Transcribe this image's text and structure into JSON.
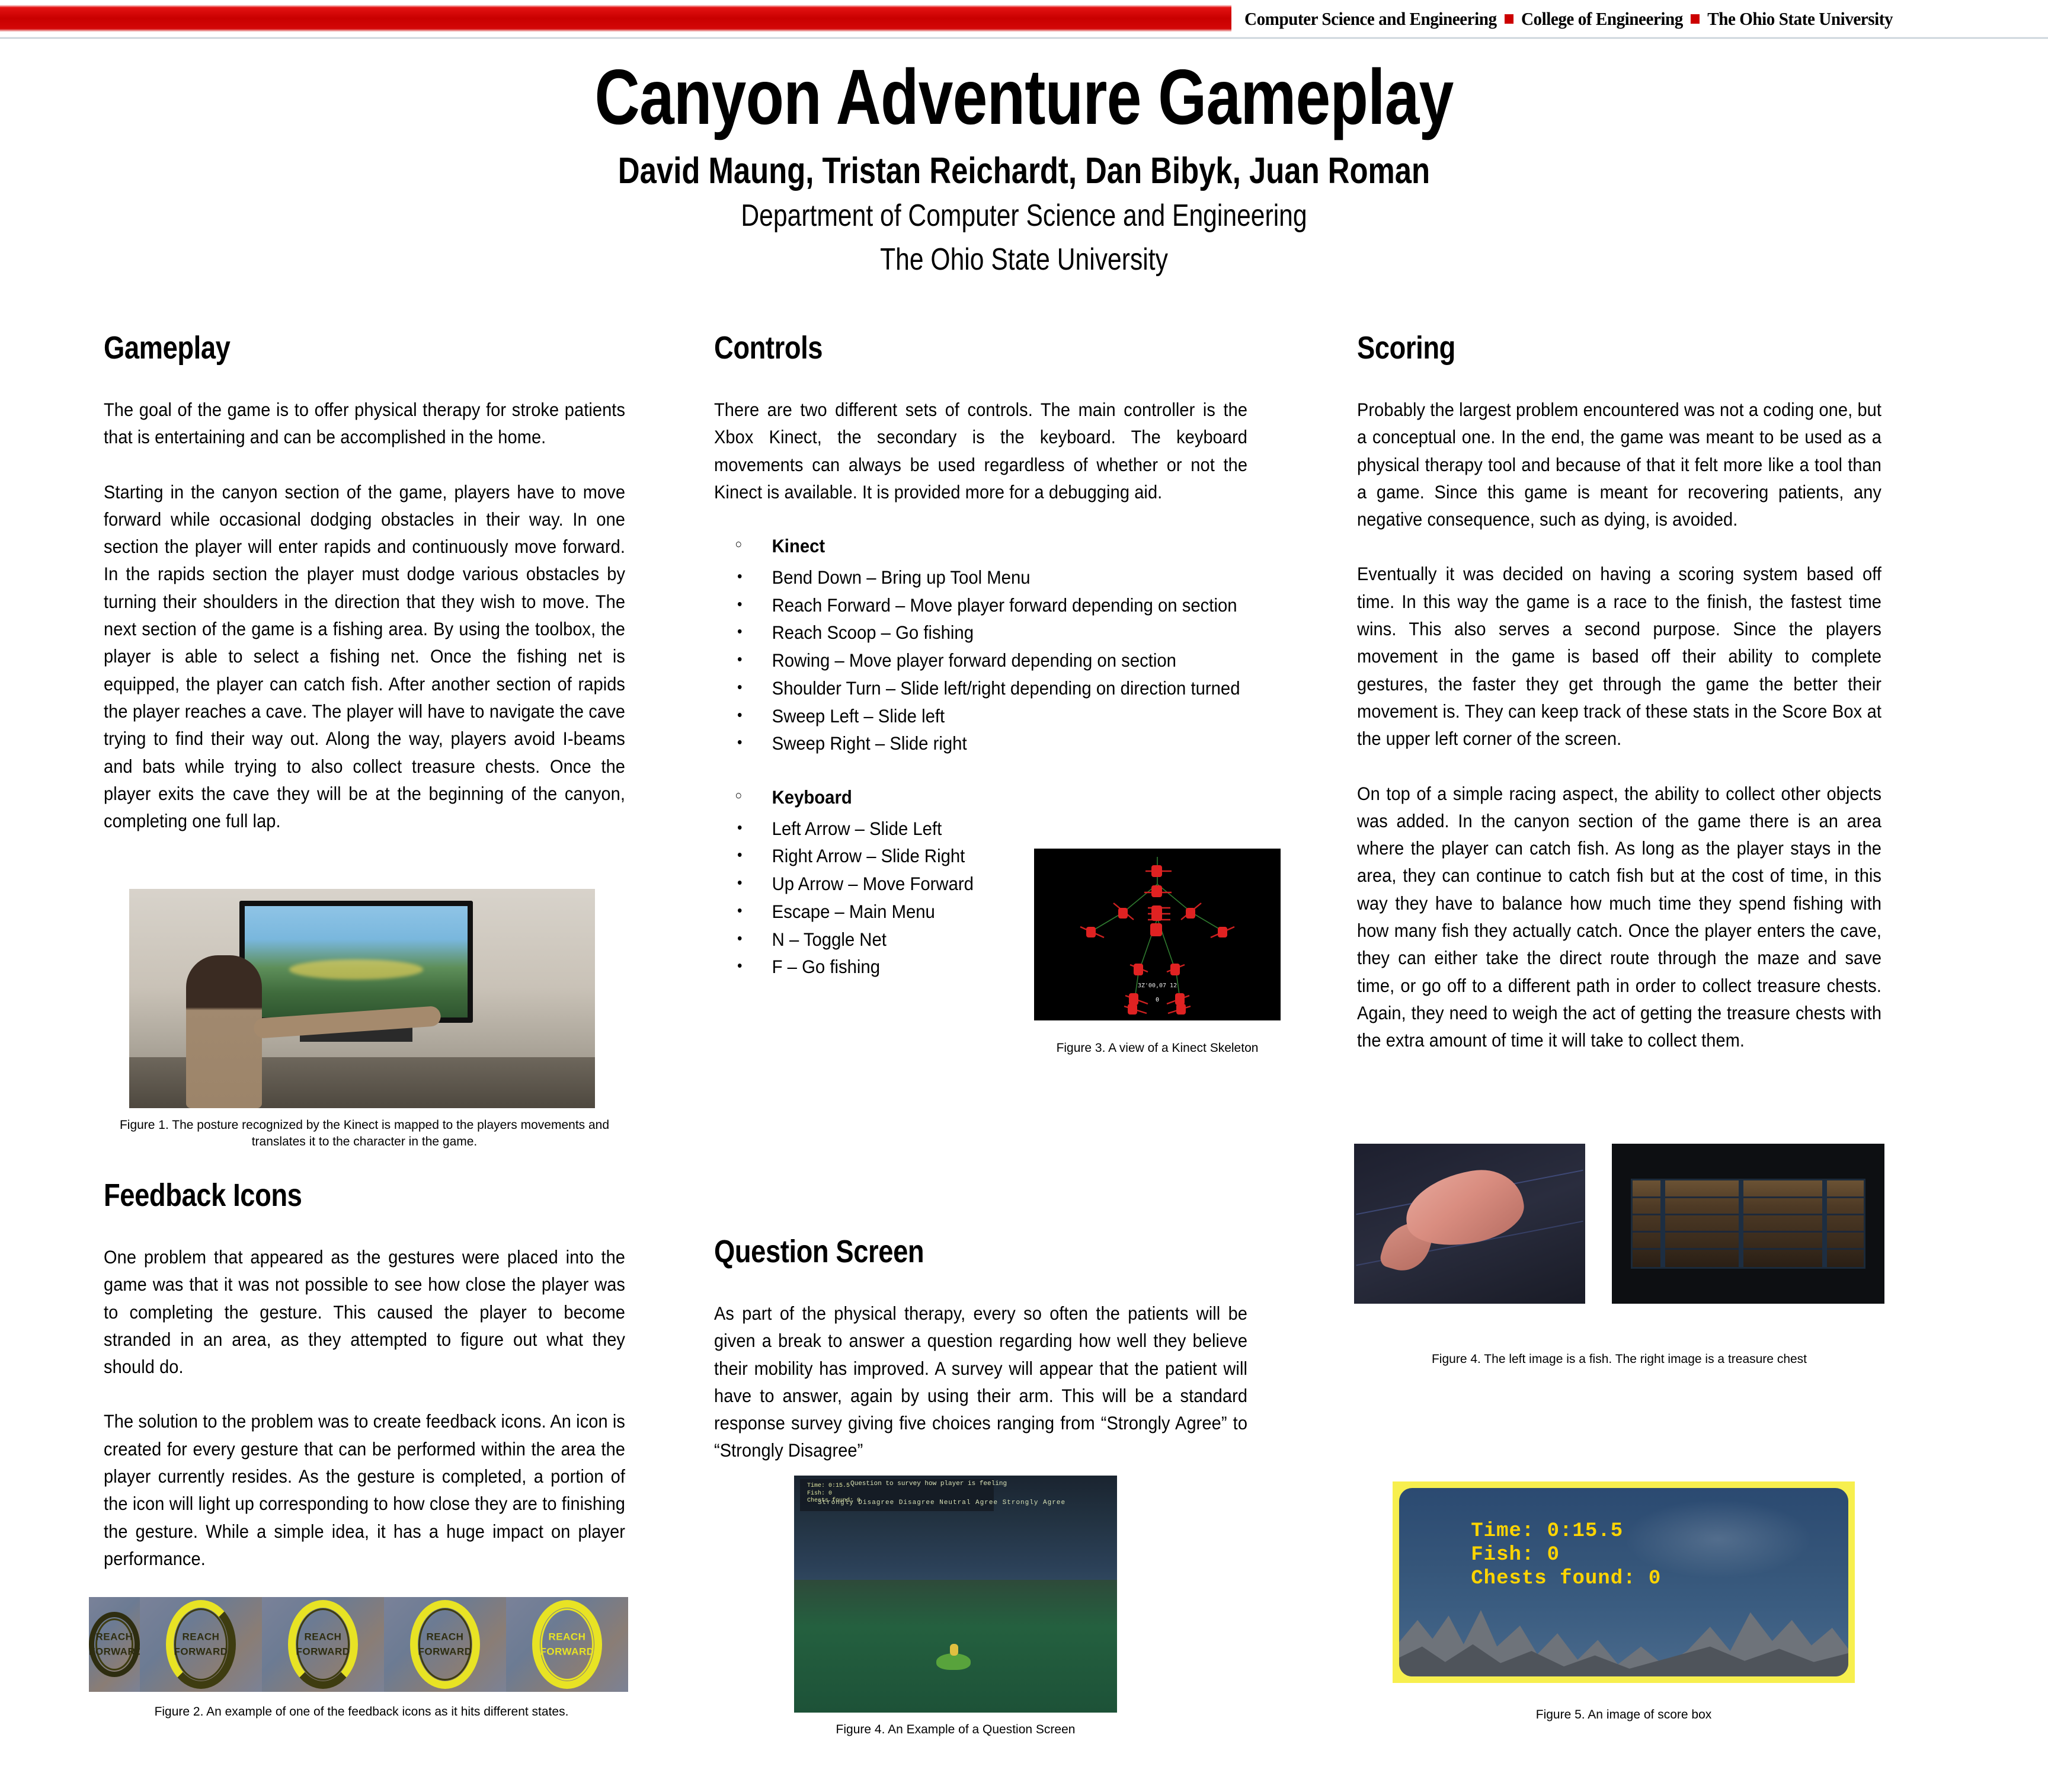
{
  "banner": {
    "items": [
      "Computer Science and Engineering",
      "College of Engineering",
      "The Ohio State University"
    ],
    "red_hex": "#c90000",
    "square_hex": "#cc0000"
  },
  "header": {
    "title": "Canyon Adventure Gameplay",
    "authors": "David Maung, Tristan Reichardt, Dan Bibyk, Juan Roman",
    "department": "Department of Computer Science and Engineering",
    "university": "The Ohio State University"
  },
  "sections": {
    "gameplay": {
      "heading": "Gameplay",
      "paragraphs": [
        "The goal of the game is to offer physical therapy for stroke patients that is entertaining and can be accomplished in the home.",
        "Starting in the canyon section of the game, players have to move forward while occasional dodging obstacles in their way. In one section the player will enter rapids and continuously move forward. In the rapids section the player must dodge various obstacles by turning their shoulders in the direction that they wish to move. The next section of the game is a fishing area.  By using the toolbox, the player is able to select a fishing net.  Once the fishing net is equipped, the player can catch fish.  After another section of rapids the player reaches a cave. The player will have to navigate the cave trying to find their way out.  Along the way, players avoid I-beams and bats while trying to also collect treasure chests.  Once the player exits the cave they will be at the beginning of the canyon, completing one full lap."
      ]
    },
    "feedback_icons": {
      "heading": "Feedback Icons",
      "paragraphs": [
        "One problem that appeared as the gestures were placed into the game was that it was not possible to see how close the player was to completing the gesture. This caused the player to become stranded in an area, as they attempted to figure out what they should do.",
        "The solution to the problem was to create feedback icons. An icon is created for every gesture that can be performed within the area the player currently resides. As the gesture is completed, a portion of the icon will light up corresponding to how close they are to finishing the gesture. While a simple idea, it has a huge impact on player performance."
      ]
    },
    "controls": {
      "heading": "Controls",
      "paragraphs": [
        "There are two different sets of controls. The main controller is the Xbox Kinect, the secondary is the keyboard. The keyboard movements can always be used regardless of whether or not the Kinect is available. It is provided more for a debugging aid."
      ],
      "kinect": {
        "group_label": "Kinect",
        "items": [
          "Bend Down – Bring up Tool Menu",
          "Reach Forward – Move player forward depending on section",
          "Reach Scoop – Go fishing",
          "Rowing – Move player forward depending on section",
          "Shoulder Turn – Slide left/right depending on direction turned",
          "Sweep Left – Slide left",
          "Sweep Right – Slide right"
        ]
      },
      "keyboard": {
        "group_label": "Keyboard",
        "items": [
          "Left Arrow – Slide Left",
          "Right Arrow – Slide Right",
          "Up Arrow – Move Forward",
          "Escape – Main Menu",
          "N – Toggle Net",
          "F – Go fishing"
        ]
      }
    },
    "question_screen": {
      "heading": "Question Screen",
      "paragraphs": [
        "As part of the physical therapy, every so often the patients will be given a break to answer a question regarding how well they believe their mobility has improved. A survey will appear that the patient will have to answer, again by using their arm. This will be a standard response survey giving five choices ranging from “Strongly Agree” to “Strongly Disagree”"
      ]
    },
    "scoring": {
      "heading": "Scoring",
      "paragraphs": [
        "Probably the largest problem encountered was not a coding one, but a conceptual one. In the end, the game was meant to be used as a physical therapy tool and because of that it felt more like a tool than a game. Since this game is meant for recovering patients, any negative consequence, such as dying, is avoided.",
        "Eventually it was decided on having a scoring system based off time. In this way the game is a race to the finish, the fastest time wins. This also serves a second purpose. Since the players movement in the game is based off their ability to complete gestures, the faster they get through the game the better their movement is. They can keep track of these stats in the Score Box at the upper left corner of the screen.",
        "On top of a simple racing aspect, the ability to collect other objects was added. In the canyon section of the game there is an area where the player can catch fish. As long as the player stays in the area, they can continue to catch fish but at the cost of time, in this way they have to balance how much time they spend fishing with how many fish they actually catch. Once the player enters the cave, they can either take the direct route through the maze and save time, or go off to a different path in order to collect treasure chests. Again, they need to weigh the act of getting the treasure chests with the extra amount of time it will take to collect them."
      ]
    }
  },
  "figures": {
    "fig1_caption": "Figure 1. The posture recognized by the Kinect is mapped to the players movements and translates it to the character in the game.",
    "fig2_caption": "Figure 2. An example of one of the feedback icons as it hits different states.",
    "fig3_caption": "Figure 3. A view of a Kinect Skeleton",
    "fig4_right_caption": "Figure 4. The left image is a fish.  The right image is a treasure chest",
    "fig4_mid_caption": "Figure 4. An Example of a Question Screen",
    "fig5_caption": "Figure 5. An image of  score box",
    "feedback_icon_label": "REACH\nFORWARD",
    "question_screen_hud": "Time: 0:15.5\nFish: 0\nChests found: 0",
    "question_screen_prompt": "Question to survey how player is feeling",
    "question_screen_options": "Strongly Disagree  Disagree  Neutral  Agree  Strongly Agree",
    "score_box_text": "Time: 0:15.5\nFish: 0\nChests found: 0",
    "score_box_border_hex": "#f7ef4e",
    "score_box_text_hex": "#ffd400"
  }
}
